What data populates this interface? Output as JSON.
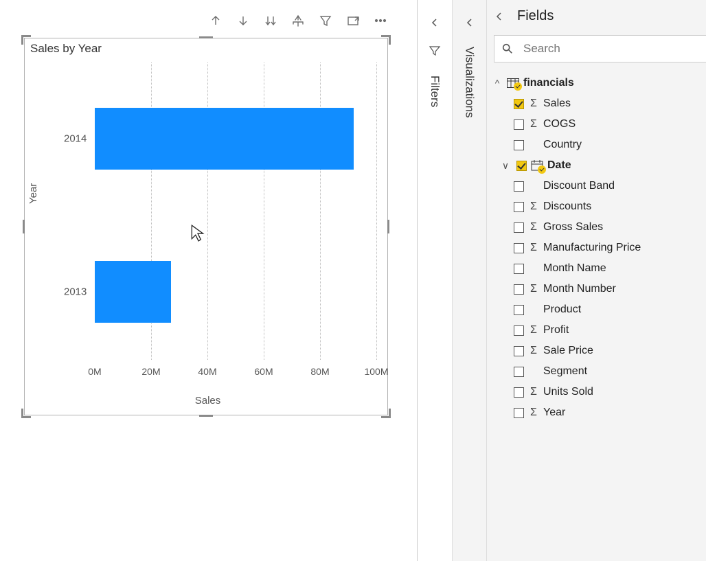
{
  "chart": {
    "title": "Sales by Year",
    "xlabel": "Sales",
    "ylabel": "Year"
  },
  "chart_data": {
    "type": "bar",
    "orientation": "horizontal",
    "categories": [
      "2014",
      "2013"
    ],
    "values": [
      92000000,
      27000000
    ],
    "xlabel": "Sales",
    "ylabel": "Year",
    "title": "Sales by Year",
    "xlim": [
      0,
      100000000
    ],
    "ticks": [
      {
        "pos": 0,
        "label": "0M"
      },
      {
        "pos": 20,
        "label": "20M"
      },
      {
        "pos": 40,
        "label": "40M"
      },
      {
        "pos": 60,
        "label": "60M"
      },
      {
        "pos": 80,
        "label": "80M"
      },
      {
        "pos": 100,
        "label": "100M"
      }
    ]
  },
  "panels": {
    "filters": "Filters",
    "visualizations": "Visualizations",
    "fields_title": "Fields",
    "search_placeholder": "Search"
  },
  "table_name": "financials",
  "fields": [
    {
      "name": "Sales",
      "checked": true,
      "sigma": true,
      "indent": 1,
      "special": ""
    },
    {
      "name": "COGS",
      "checked": false,
      "sigma": true,
      "indent": 1,
      "special": ""
    },
    {
      "name": "Country",
      "checked": false,
      "sigma": false,
      "indent": 1,
      "special": ""
    },
    {
      "name": "Date",
      "checked": true,
      "sigma": false,
      "indent": 1,
      "special": "date",
      "caret": "v",
      "bold": true
    },
    {
      "name": "Discount Band",
      "checked": false,
      "sigma": false,
      "indent": 1,
      "special": ""
    },
    {
      "name": "Discounts",
      "checked": false,
      "sigma": true,
      "indent": 1,
      "special": ""
    },
    {
      "name": "Gross Sales",
      "checked": false,
      "sigma": true,
      "indent": 1,
      "special": ""
    },
    {
      "name": "Manufacturing Price",
      "checked": false,
      "sigma": true,
      "indent": 1,
      "special": ""
    },
    {
      "name": "Month Name",
      "checked": false,
      "sigma": false,
      "indent": 1,
      "special": ""
    },
    {
      "name": "Month Number",
      "checked": false,
      "sigma": true,
      "indent": 1,
      "special": ""
    },
    {
      "name": "Product",
      "checked": false,
      "sigma": false,
      "indent": 1,
      "special": ""
    },
    {
      "name": "Profit",
      "checked": false,
      "sigma": true,
      "indent": 1,
      "special": ""
    },
    {
      "name": "Sale Price",
      "checked": false,
      "sigma": true,
      "indent": 1,
      "special": ""
    },
    {
      "name": "Segment",
      "checked": false,
      "sigma": false,
      "indent": 1,
      "special": ""
    },
    {
      "name": "Units Sold",
      "checked": false,
      "sigma": true,
      "indent": 1,
      "special": ""
    },
    {
      "name": "Year",
      "checked": false,
      "sigma": true,
      "indent": 1,
      "special": ""
    }
  ]
}
